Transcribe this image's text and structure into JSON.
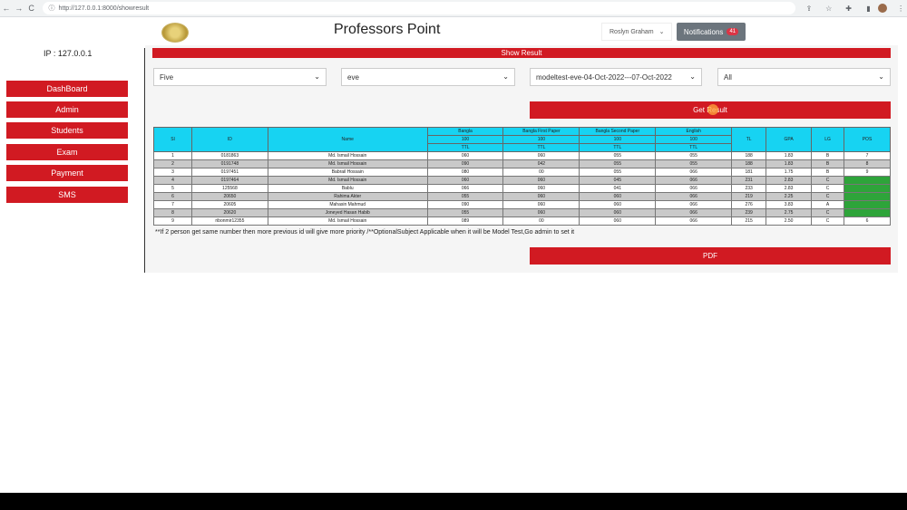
{
  "browser": {
    "url": "http://127.0.0.1:8000/showresult",
    "back": "←",
    "forward": "→",
    "reload": "C"
  },
  "header": {
    "title": "Professors Point",
    "user": "Roslyn Graham",
    "notifications_label": "Notifications",
    "notifications_count": "41"
  },
  "sidebar": {
    "ip": "IP : 127.0.0.1",
    "items": [
      "DashBoard",
      "Admin",
      "Students",
      "Exam",
      "Payment",
      "SMS"
    ]
  },
  "main": {
    "section_title": "Show Result",
    "filters": [
      "Five",
      "eve",
      "modeltest-eve-04-Oct-2022---07-Oct-2022",
      "All"
    ],
    "get_result": "Get Result",
    "table": {
      "headers": [
        "Sl",
        "ID",
        "Name",
        "Bangla",
        "Bangla First Paper",
        "Bangla Second Paper",
        "English",
        "TL",
        "GPA",
        "LG",
        "POS"
      ],
      "full_marks": "100",
      "sub_label": "TTL",
      "rows": [
        [
          "1",
          "0181863",
          "Md. Ismail Hossain",
          "060",
          "060",
          "055",
          "055",
          "188",
          "1.83",
          "B",
          "7"
        ],
        [
          "2",
          "0191748",
          "Md. Ismail Hossain",
          "090",
          "042",
          "055",
          "055",
          "188",
          "1.83",
          "B",
          "8"
        ],
        [
          "3",
          "0197451",
          "Babrail Hossain",
          "080",
          "00",
          "055",
          "066",
          "181",
          "1.75",
          "B",
          "9"
        ],
        [
          "4",
          "0197464",
          "Md. Ismail Hossain",
          "060",
          "060",
          "045",
          "066",
          "231",
          "2.83",
          "C",
          "4"
        ],
        [
          "5",
          "125568",
          "Bablu",
          "066",
          "060",
          "041",
          "066",
          "233",
          "2.83",
          "C",
          "3"
        ],
        [
          "6",
          "20650",
          "Rahima Akter",
          "055",
          "060",
          "060",
          "066",
          "219",
          "2.25",
          "C",
          "5"
        ],
        [
          "7",
          "20605",
          "Mahasin Mahmud",
          "090",
          "060",
          "060",
          "066",
          "276",
          "3.83",
          "A",
          "1"
        ],
        [
          "8",
          "20620",
          "Joneyed Hasan Habib",
          "055",
          "060",
          "060",
          "066",
          "239",
          "2.75",
          "C",
          "2"
        ],
        [
          "9",
          "ribonmir12355",
          "Md. Ismail Hossain",
          "089",
          "00",
          "060",
          "066",
          "215",
          "2.50",
          "C",
          "6"
        ]
      ]
    },
    "note": "**If 2 person get same number then more previous id will give more priority /**OptionalSubject Applicable when it will be Model Test,Go admin to set it",
    "pdf": "PDF"
  },
  "colors": {
    "accent": "#d11a22",
    "table_header": "#17d3f2",
    "highlight": "#2ea43a"
  }
}
